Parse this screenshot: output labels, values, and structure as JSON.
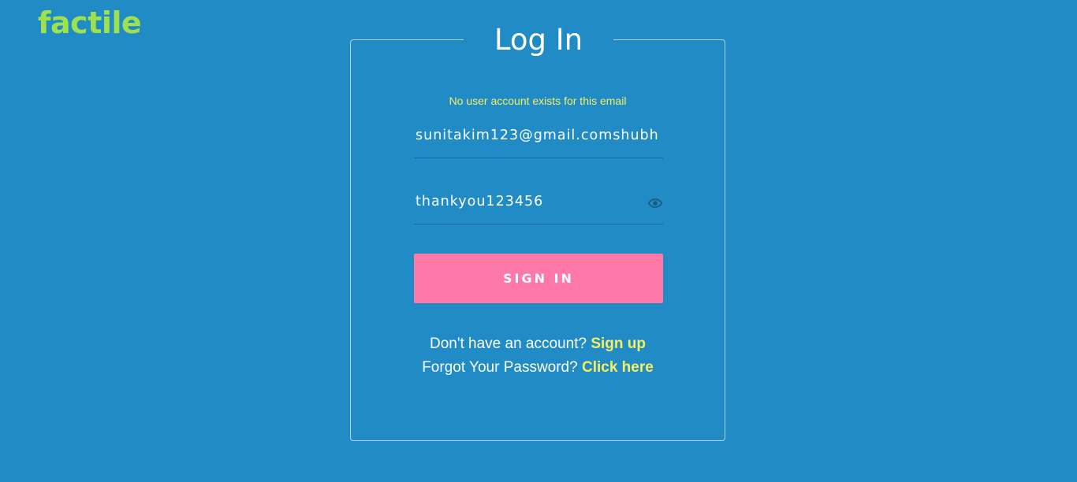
{
  "app": {
    "logo_text": "factile"
  },
  "login": {
    "title": "Log In",
    "error_message": "No user account exists for this email",
    "email": {
      "value": "sunitakim123@gmail.comshubh"
    },
    "password": {
      "value": "thankyou123456",
      "toggle_icon": "eye-icon"
    },
    "submit_label": "SIGN IN",
    "signup_prompt": "Don't have an account?",
    "signup_link": "Sign up",
    "forgot_prompt": "Forgot Your Password?",
    "forgot_link": "Click here"
  },
  "colors": {
    "background": "#218bc5",
    "logo": "#9ee04d",
    "highlight": "#f6ef62",
    "button": "#fe79a8"
  }
}
